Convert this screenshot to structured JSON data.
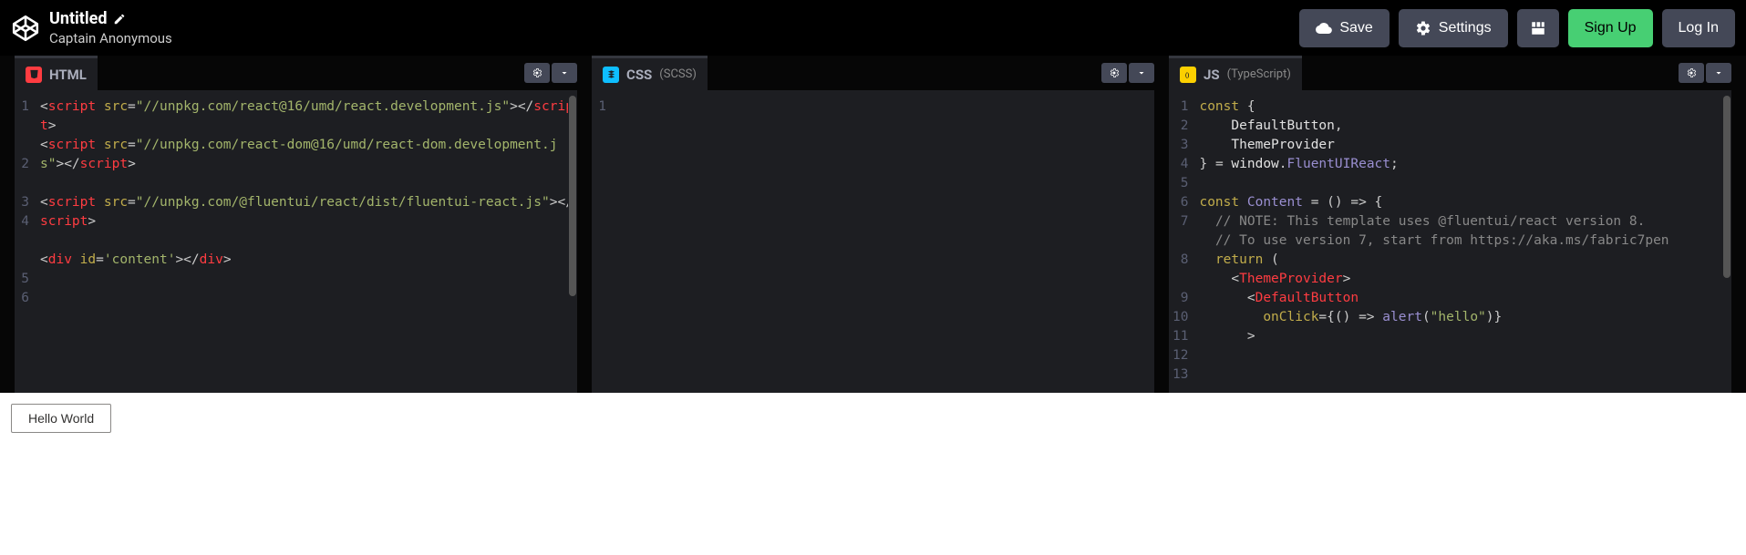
{
  "header": {
    "title": "Untitled",
    "author": "Captain Anonymous",
    "buttons": {
      "save": "Save",
      "settings": "Settings",
      "signup": "Sign Up",
      "login": "Log In"
    }
  },
  "panels": {
    "html": {
      "name": "HTML",
      "sub": "",
      "lines": [
        "1",
        "2",
        "3",
        "4",
        "5",
        "6"
      ]
    },
    "css": {
      "name": "CSS",
      "sub": "(SCSS)",
      "lines": [
        "1"
      ]
    },
    "js": {
      "name": "JS",
      "sub": "(TypeScript)",
      "lines": [
        "1",
        "2",
        "3",
        "4",
        "5",
        "6",
        "7",
        "8",
        "9",
        "10",
        "11",
        "12",
        "13"
      ]
    }
  },
  "code": {
    "html": {
      "l1a": "<",
      "l1b": "script",
      "l1c": " src",
      "l1d": "=",
      "l1e": "\"//unpkg.com/react@16/umd/react.development.js\"",
      "l1f": "></",
      "l1g": "script",
      "l1h": ">",
      "l2a": "<",
      "l2b": "script",
      "l2c": " src",
      "l2d": "=",
      "l2e": "\"//unpkg.com/react-dom@16/umd/react-dom.development.js\"",
      "l2f": "></",
      "l2g": "script",
      "l2h": ">",
      "l4a": "<",
      "l4b": "script",
      "l4c": " src",
      "l4d": "=",
      "l4e": "\"//unpkg.com/@fluentui/react/dist/fluentui-react.js\"",
      "l4f": "></",
      "l4g": "script",
      "l4h": ">",
      "l6a": "<",
      "l6b": "div",
      "l6c": " id",
      "l6d": "=",
      "l6e": "'content'",
      "l6f": "></",
      "l6g": "div",
      "l6h": ">"
    },
    "js": {
      "l1a": "const",
      "l1b": " {",
      "l2a": "    DefaultButton",
      "l2b": ",",
      "l3a": "    ThemeProvider",
      "l4a": "} ",
      "l4b": "=",
      "l4c": " window",
      "l4d": ".",
      "l4e": "FluentUIReact",
      "l4f": ";",
      "l6a": "const",
      "l6b": " ",
      "l6c": "Content",
      "l6d": " ",
      "l6e": "=",
      "l6f": " () ",
      "l6g": "=>",
      "l6h": " {",
      "l7a": "  // NOTE: This template uses @fluentui/react version 8.",
      "l8a": "  // To use version 7, start from https://aka.ms/fabric7pen",
      "l9a": "  ",
      "l9b": "return",
      "l9c": " (",
      "l10a": "    <",
      "l10b": "ThemeProvider",
      "l10c": ">",
      "l11a": "      <",
      "l11b": "DefaultButton",
      "l12a": "        onClick",
      "l12b": "=",
      "l12c": "{() ",
      "l12d": "=>",
      "l12e": " ",
      "l12f": "alert",
      "l12g": "(",
      "l12h": "\"hello\"",
      "l12i": ")}",
      "l13a": "      >"
    }
  },
  "output": {
    "button_label": "Hello World"
  }
}
